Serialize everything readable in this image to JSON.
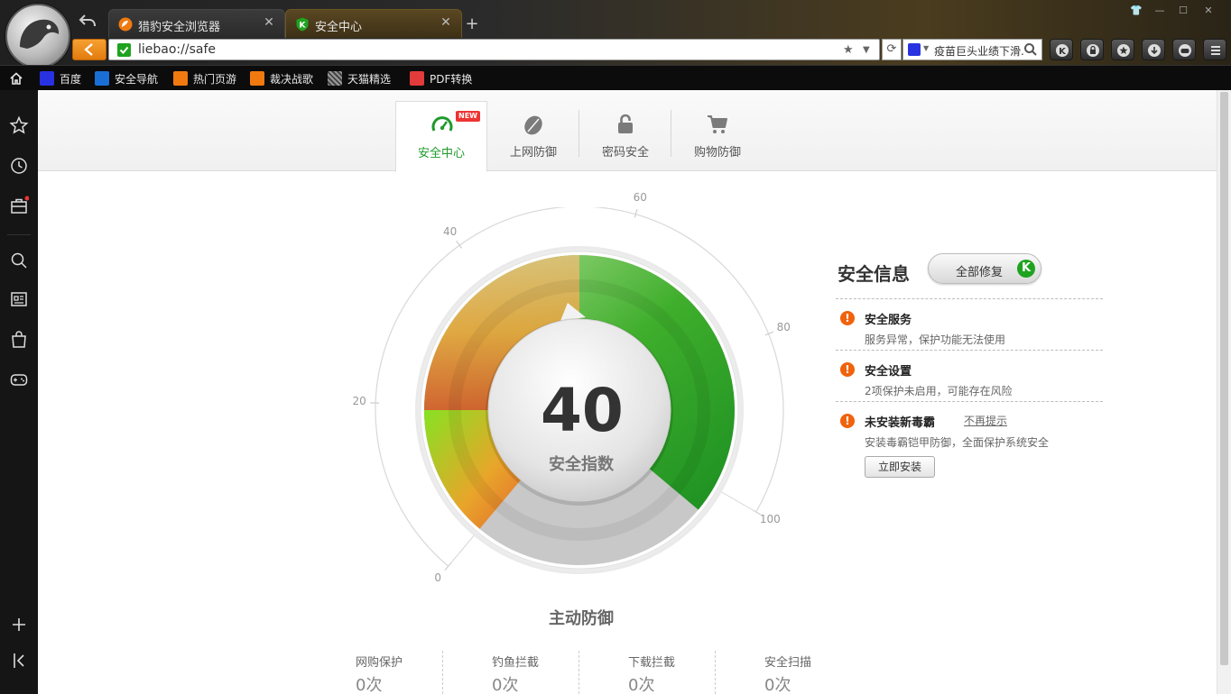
{
  "tabs": [
    {
      "title": "猎豹安全浏览器",
      "icon": "cheetah-icon",
      "active": false
    },
    {
      "title": "安全中心",
      "icon": "shield-k-icon",
      "active": true
    }
  ],
  "address": {
    "url": "liebao://safe"
  },
  "search": {
    "text": "疫苗巨头业绩下滑..."
  },
  "bookmarks": [
    {
      "label": "百度",
      "icon": "baidu-icon",
      "color": "#2932e1"
    },
    {
      "label": "安全导航",
      "icon": "k-shield-icon",
      "color": "#1a6fd6"
    },
    {
      "label": "热门页游",
      "icon": "k-orange-icon",
      "color": "#f07a10"
    },
    {
      "label": "裁决战歌",
      "icon": "k-orange-icon",
      "color": "#f07a10"
    },
    {
      "label": "天猫精选",
      "icon": "tmall-icon",
      "color": "#888888"
    },
    {
      "label": "PDF转换",
      "icon": "pdf-icon",
      "color": "#e23b3b"
    }
  ],
  "nav": {
    "new_badge": "NEW",
    "tabs": [
      {
        "label": "安全中心",
        "icon": "speedometer-icon",
        "active": true
      },
      {
        "label": "上网防御",
        "icon": "leaf-shield-icon",
        "active": false
      },
      {
        "label": "密码安全",
        "icon": "lock-icon",
        "active": false
      },
      {
        "label": "购物防御",
        "icon": "cart-icon",
        "active": false
      }
    ]
  },
  "gauge": {
    "score": "40",
    "score_label": "安全指数",
    "bottom_label": "主动防御",
    "ticks": [
      "0",
      "20",
      "40",
      "60",
      "80",
      "100"
    ],
    "value_fraction": 0.4,
    "colors": {
      "green": "#2aa52a",
      "orange": "#f0911f",
      "red": "#e2552b",
      "grey": "#bdbdbd"
    }
  },
  "stats": [
    {
      "label": "网购保护",
      "value": "0次"
    },
    {
      "label": "钓鱼拦截",
      "value": "0次"
    },
    {
      "label": "下载拦截",
      "value": "0次"
    },
    {
      "label": "安全扫描",
      "value": "0次"
    }
  ],
  "security": {
    "title": "安全信息",
    "fix_all": "全部修复",
    "items": [
      {
        "title": "安全服务",
        "desc": "服务异常，保护功能无法使用"
      },
      {
        "title": "安全设置",
        "desc": "2项保护未启用，可能存在风险"
      },
      {
        "title": "未安装新毒霸",
        "desc": "安装毒霸铠甲防御，全面保护系统安全",
        "dismiss": "不再提示",
        "action": "立即安装"
      }
    ]
  }
}
